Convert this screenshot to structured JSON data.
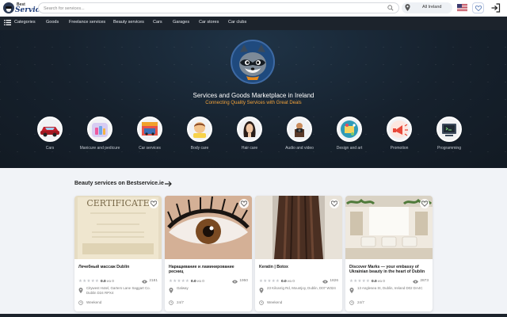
{
  "header": {
    "logo_small": "Best",
    "logo_big": "Service",
    "search_placeholder": "Search for services...",
    "location": "All Ireland",
    "icons": [
      "search-icon",
      "location-pin-icon",
      "us-flag-icon",
      "heart-icon",
      "login-icon"
    ]
  },
  "nav": {
    "categories_label": "Categories",
    "items": [
      "Goods",
      "Freelance services",
      "Beauty services",
      "Cars",
      "Garages",
      "Car stores",
      "Car clubs"
    ]
  },
  "hero": {
    "title": "Services and Goods Marketplace in Ireland",
    "subtitle": "Connecting Quality Services with Great Deals",
    "accent_color": "#f2a23a",
    "categories": [
      {
        "label": "Cars",
        "icon": "car-icon"
      },
      {
        "label": "Manicure and pedicure",
        "icon": "nail-polish-icon"
      },
      {
        "label": "Car services",
        "icon": "car-service-icon"
      },
      {
        "label": "Body care",
        "icon": "body-care-icon"
      },
      {
        "label": "Hair care",
        "icon": "hair-care-icon"
      },
      {
        "label": "Audio and video",
        "icon": "camera-icon"
      },
      {
        "label": "Design and art",
        "icon": "design-art-icon"
      },
      {
        "label": "Promotion",
        "icon": "promotion-icon"
      },
      {
        "label": "Programming",
        "icon": "programming-icon"
      }
    ]
  },
  "section": {
    "title": "Beauty services on Bestservice.ie"
  },
  "cards": [
    {
      "title": "Лечебный массаж Dublin",
      "stars": "★★★★★",
      "rating": "0.0",
      "count": "из 0",
      "views": "2181",
      "address": "Citywest Hotel, Garters Lane Saggart Co. Dublin D24 RPX4",
      "hours": "Weekend",
      "photo_text": "CERTIFICATE"
    },
    {
      "title": "Наращивание и ламинирование ресниц",
      "stars": "★★★★★",
      "rating": "0.0",
      "count": "из 0",
      "views": "1950",
      "address": "Galway",
      "hours": "24/7"
    },
    {
      "title": "Keratin | Botox",
      "stars": "★★★★★",
      "rating": "0.0",
      "count": "из 0",
      "views": "1826",
      "address": "23 Kilcarrig Rd, Mountjoy, Dublin, D07 W324",
      "hours": "Weekend"
    },
    {
      "title": "Discover Marks — your embassy of Ukrainian beauty in the heart of Dublin",
      "stars": "★★★★★",
      "rating": "0.0",
      "count": "из 0",
      "views": "2873",
      "address": "13 Anglesea St, Dublin, Ireland D02 DA4C",
      "hours": "24/7"
    }
  ]
}
